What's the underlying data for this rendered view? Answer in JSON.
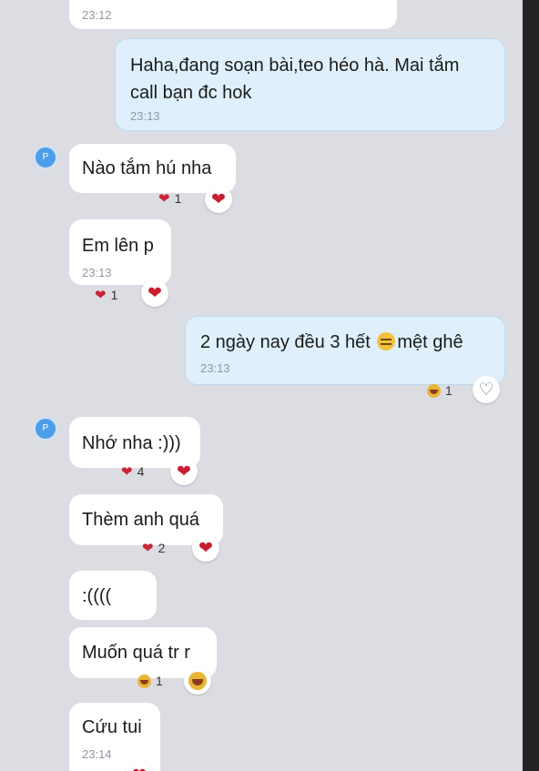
{
  "colors": {
    "background": "#dcdde3",
    "incoming_bubble": "#ffffff",
    "outgoing_bubble": "#dff0fc",
    "heart": "#c81e30",
    "avatar": "#4d9ee8"
  },
  "avatar_letter": "P",
  "messages": [
    {
      "id": "m0",
      "direction": "incoming",
      "text": "",
      "time": "23:12"
    },
    {
      "id": "m1",
      "direction": "outgoing",
      "text": "Haha,đang soạn bài,teo héo hà. Mai tắm call bạn đc hok",
      "time": "23:13"
    },
    {
      "id": "m2",
      "direction": "incoming",
      "text": "Nào tắm hú nha",
      "reaction_icon": "heart-icon",
      "reaction_count": "1"
    },
    {
      "id": "m3",
      "direction": "incoming",
      "text": "Em lên p",
      "time": "23:13",
      "reaction_icon": "heart-icon",
      "reaction_count": "1"
    },
    {
      "id": "m4",
      "direction": "outgoing",
      "text_before": "2 ngày nay đều 3 hết",
      "inline_emoji": "expressionless-face-icon",
      "text_after": "mệt ghê",
      "time": "23:13",
      "reaction_icon": "laughing-face-icon",
      "reaction_count": "1"
    },
    {
      "id": "m5",
      "direction": "incoming",
      "text": "Nhớ nha :)))",
      "reaction_icon": "heart-icon",
      "reaction_count": "4"
    },
    {
      "id": "m6",
      "direction": "incoming",
      "text": "Thèm anh quá",
      "reaction_icon": "heart-icon",
      "reaction_count": "2"
    },
    {
      "id": "m7",
      "direction": "incoming",
      "text": ":(((("
    },
    {
      "id": "m8",
      "direction": "incoming",
      "text": "Muốn quá tr r",
      "reaction_icon": "laughing-face-icon",
      "reaction_count": "1"
    },
    {
      "id": "m9",
      "direction": "incoming",
      "text": "Cứu tui",
      "time": "23:14"
    }
  ]
}
